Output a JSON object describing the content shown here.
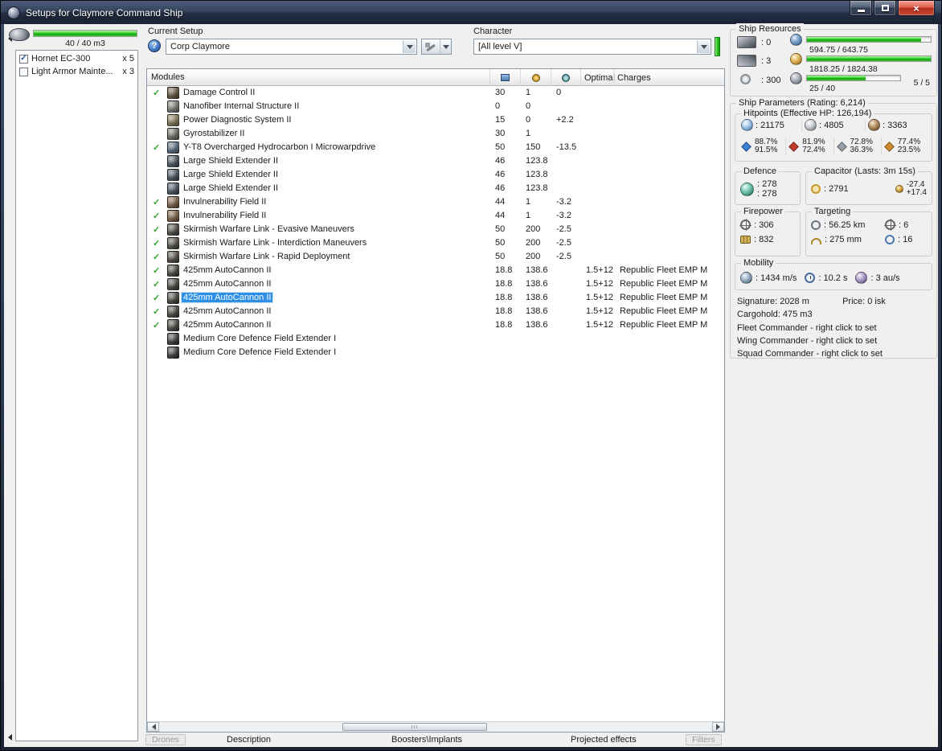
{
  "window": {
    "title": "Setups for Claymore Command Ship"
  },
  "left_panel": {
    "drone_bay_label": "40 / 40 m3",
    "drone_bay_pct": 100,
    "drones": [
      {
        "checked": true,
        "name": "Hornet EC-300",
        "qty": "x 5"
      },
      {
        "checked": false,
        "name": "Light Armor Mainte...",
        "qty": "x 3"
      }
    ]
  },
  "setup": {
    "label": "Current Setup",
    "value": "Corp Claymore"
  },
  "character": {
    "label": "Character",
    "value": "[All level V]"
  },
  "modules_table": {
    "headers": {
      "modules": "Modules",
      "optimal": "Optimal",
      "charges": "Charges"
    },
    "rows": [
      {
        "active": true,
        "selected": false,
        "name": "Damage Control II",
        "cpu": "30",
        "pg": "1",
        "cap": "0",
        "optimal": "",
        "charges": "",
        "icon": "damage-control-icon",
        "color": "#6e5b44"
      },
      {
        "active": false,
        "selected": false,
        "name": "Nanofiber Internal Structure II",
        "cpu": "0",
        "pg": "0",
        "cap": "",
        "optimal": "",
        "charges": "",
        "icon": "nanofiber-structure-icon",
        "color": "#8d8d83"
      },
      {
        "active": false,
        "selected": false,
        "name": "Power Diagnostic System II",
        "cpu": "15",
        "pg": "0",
        "cap": "+2.2",
        "optimal": "",
        "charges": "",
        "icon": "power-diagnostic-icon",
        "color": "#9c8a62"
      },
      {
        "active": false,
        "selected": false,
        "name": "Gyrostabilizer II",
        "cpu": "30",
        "pg": "1",
        "cap": "",
        "optimal": "",
        "charges": "",
        "icon": "gyrostabilizer-icon",
        "color": "#7d7d74"
      },
      {
        "active": true,
        "selected": false,
        "name": "Y-T8 Overcharged Hydrocarbon I Microwarpdrive",
        "cpu": "50",
        "pg": "150",
        "cap": "-13.5",
        "optimal": "",
        "charges": "",
        "icon": "microwarpdrive-icon",
        "color": "#5f7990"
      },
      {
        "active": false,
        "selected": false,
        "name": "Large Shield Extender II",
        "cpu": "46",
        "pg": "123.8",
        "cap": "",
        "optimal": "",
        "charges": "",
        "icon": "shield-extender-icon",
        "color": "#4e5c6b"
      },
      {
        "active": false,
        "selected": false,
        "name": "Large Shield Extender II",
        "cpu": "46",
        "pg": "123.8",
        "cap": "",
        "optimal": "",
        "charges": "",
        "icon": "shield-extender-icon",
        "color": "#4e5c6b"
      },
      {
        "active": false,
        "selected": false,
        "name": "Large Shield Extender II",
        "cpu": "46",
        "pg": "123.8",
        "cap": "",
        "optimal": "",
        "charges": "",
        "icon": "shield-extender-icon",
        "color": "#4e5c6b"
      },
      {
        "active": true,
        "selected": false,
        "name": "Invulnerability Field II",
        "cpu": "44",
        "pg": "1",
        "cap": "-3.2",
        "optimal": "",
        "charges": "",
        "icon": "invulnerability-field-icon",
        "color": "#8c6a46"
      },
      {
        "active": true,
        "selected": false,
        "name": "Invulnerability Field II",
        "cpu": "44",
        "pg": "1",
        "cap": "-3.2",
        "optimal": "",
        "charges": "",
        "icon": "invulnerability-field-icon",
        "color": "#8c6a46"
      },
      {
        "active": true,
        "selected": false,
        "name": "Skirmish Warfare Link - Evasive Maneuvers",
        "cpu": "50",
        "pg": "200",
        "cap": "-2.5",
        "optimal": "",
        "charges": "",
        "icon": "warfare-link-icon",
        "color": "#57524b"
      },
      {
        "active": true,
        "selected": false,
        "name": "Skirmish Warfare Link - Interdiction Maneuvers",
        "cpu": "50",
        "pg": "200",
        "cap": "-2.5",
        "optimal": "",
        "charges": "",
        "icon": "warfare-link-icon",
        "color": "#57524b"
      },
      {
        "active": true,
        "selected": false,
        "name": "Skirmish Warfare Link - Rapid Deployment",
        "cpu": "50",
        "pg": "200",
        "cap": "-2.5",
        "optimal": "",
        "charges": "",
        "icon": "warfare-link-icon",
        "color": "#57524b"
      },
      {
        "active": true,
        "selected": false,
        "name": "425mm AutoCannon II",
        "cpu": "18.8",
        "pg": "138.6",
        "cap": "",
        "optimal": "1.5+12",
        "charges": "Republic Fleet EMP M",
        "icon": "autocannon-icon",
        "color": "#4b4b43"
      },
      {
        "active": true,
        "selected": false,
        "name": "425mm AutoCannon II",
        "cpu": "18.8",
        "pg": "138.6",
        "cap": "",
        "optimal": "1.5+12",
        "charges": "Republic Fleet EMP M",
        "icon": "autocannon-icon",
        "color": "#4b4b43"
      },
      {
        "active": true,
        "selected": true,
        "name": "425mm AutoCannon II",
        "cpu": "18.8",
        "pg": "138.6",
        "cap": "",
        "optimal": "1.5+12",
        "charges": "Republic Fleet EMP M",
        "icon": "autocannon-icon",
        "color": "#4b4b43"
      },
      {
        "active": true,
        "selected": false,
        "name": "425mm AutoCannon II",
        "cpu": "18.8",
        "pg": "138.6",
        "cap": "",
        "optimal": "1.5+12",
        "charges": "Republic Fleet EMP M",
        "icon": "autocannon-icon",
        "color": "#4b4b43"
      },
      {
        "active": true,
        "selected": false,
        "name": "425mm AutoCannon II",
        "cpu": "18.8",
        "pg": "138.6",
        "cap": "",
        "optimal": "1.5+12",
        "charges": "Republic Fleet EMP M",
        "icon": "autocannon-icon",
        "color": "#4b4b43"
      },
      {
        "active": false,
        "selected": false,
        "name": "Medium Core Defence Field Extender I",
        "cpu": "",
        "pg": "",
        "cap": "",
        "optimal": "",
        "charges": "",
        "icon": "rig-icon",
        "color": "#3b3b37"
      },
      {
        "active": false,
        "selected": false,
        "name": "Medium Core Defence Field Extender I",
        "cpu": "",
        "pg": "",
        "cap": "",
        "optimal": "",
        "charges": "",
        "icon": "rig-icon",
        "color": "#3b3b37"
      }
    ]
  },
  "tabs": {
    "drones": "Drones",
    "description": "Description",
    "boosters": "Boosters\\Implants",
    "projected": "Projected effects",
    "filters": "Filters"
  },
  "ship_resources": {
    "label": "Ship Resources",
    "turret_hardpoints": "0",
    "launcher_hardpoints": "3",
    "calibration": "300",
    "cpu": {
      "text": "594.75 / 643.75",
      "pct": 92.4
    },
    "powergrid": {
      "text": "1818.25 / 1824.38",
      "pct": 99.7
    },
    "drone_bay": {
      "text": "25 / 40",
      "pct": 62.5
    },
    "drones_active": "5 / 5"
  },
  "ship_parameters": {
    "label": "Ship Parameters (Rating: 6,214)",
    "hitpoints": {
      "label": "Hitpoints (Effective HP: 126,194)",
      "shield": "21175",
      "armor": "4805",
      "structure": "3363",
      "resists": {
        "em": {
          "shield": "88.7%",
          "armor": "91.5%"
        },
        "thermal": {
          "shield": "81.9%",
          "armor": "72.4%"
        },
        "kinetic": {
          "shield": "72.8%",
          "armor": "36.3%"
        },
        "explosive": {
          "shield": "77.4%",
          "armor": "23.5%"
        }
      }
    },
    "defence": {
      "label": "Defence",
      "value1": "278",
      "value2": "278"
    },
    "capacitor": {
      "label": "Capacitor (Lasts: 3m 15s)",
      "capacity": "2791",
      "delta": "-27.4",
      "recharge": "+17.4"
    },
    "firepower": {
      "label": "Firepower",
      "dps": "306",
      "volley": "832"
    },
    "targeting": {
      "label": "Targeting",
      "range": "56.25 km",
      "max_targets": "6",
      "scan_resolution": "275 mm",
      "sensor_strength": "16"
    },
    "mobility": {
      "label": "Mobility",
      "speed": "1434 m/s",
      "align_time": "10.2 s",
      "warp_speed": "3 au/s"
    },
    "signature": "Signature: 2028 m",
    "price": "Price: 0 isk",
    "cargohold": "Cargohold: 475 m3",
    "fleet_commander": "Fleet Commander - right click to set",
    "wing_commander": "Wing Commander - right click to set",
    "squad_commander": "Squad Commander - right click to set"
  }
}
